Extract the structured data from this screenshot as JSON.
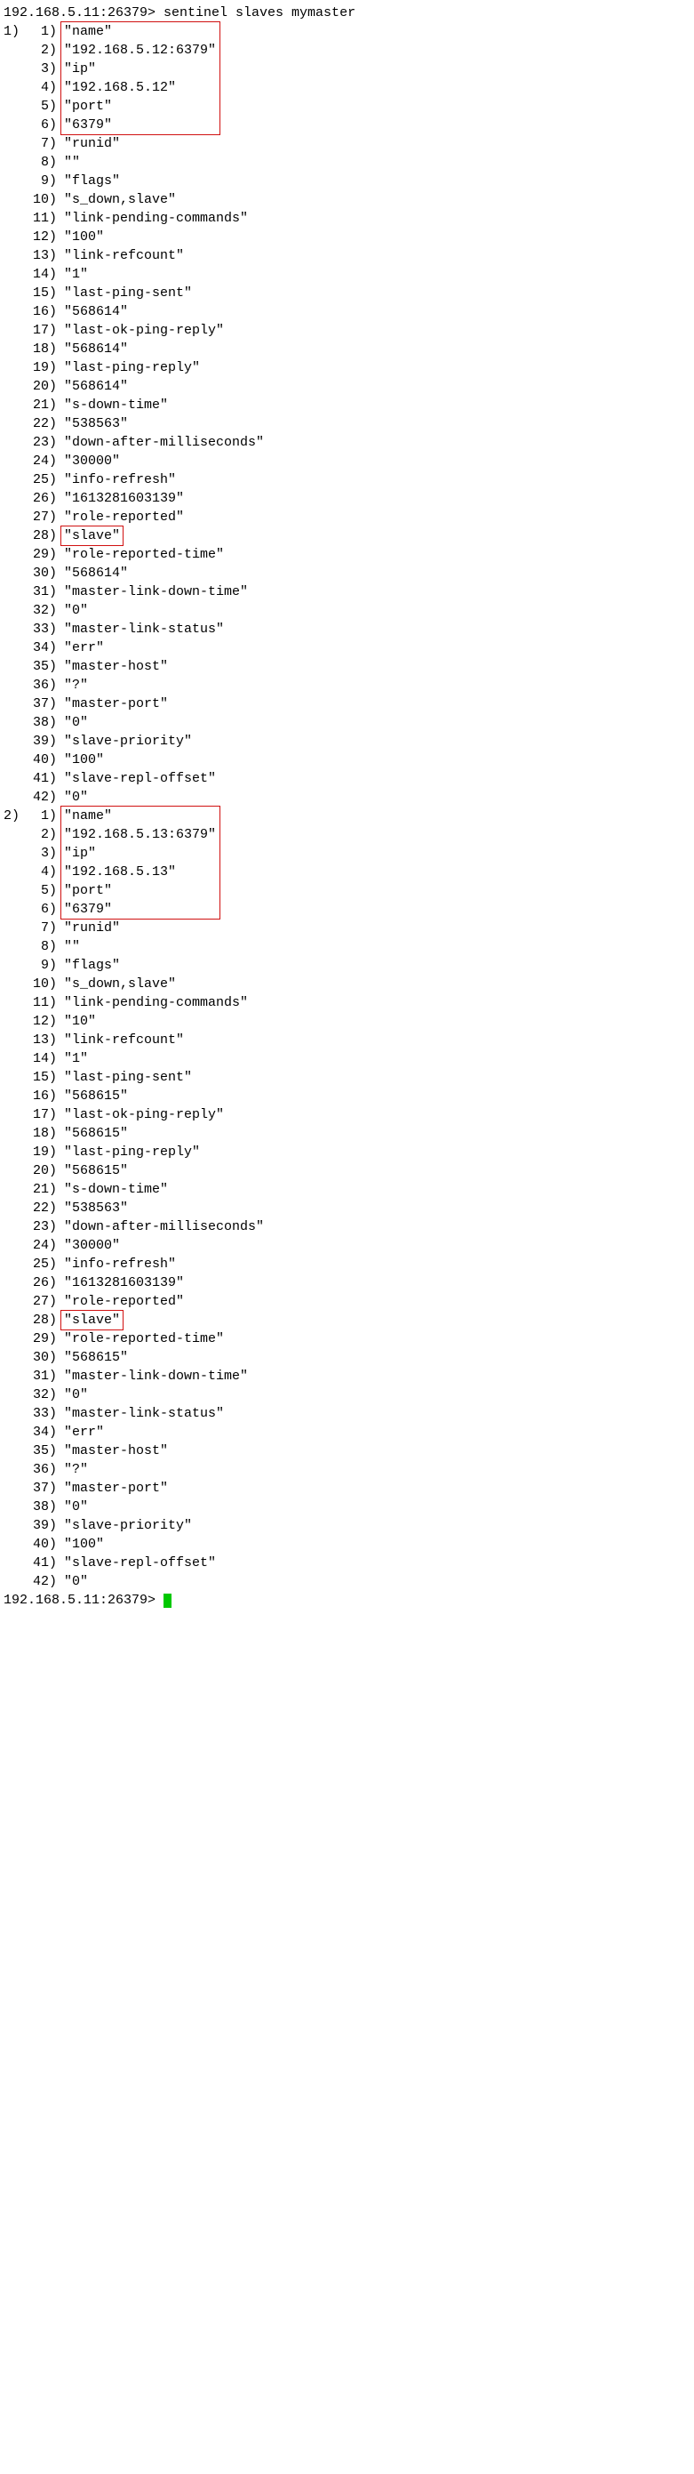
{
  "prompt_host": "192.168.5.11:26379>",
  "command": "sentinel slaves mymaster",
  "groups": [
    {
      "items": [
        "\"name\"",
        "\"192.168.5.12:6379\"",
        "\"ip\"",
        "\"192.168.5.12\"",
        "\"port\"",
        "\"6379\"",
        "\"runid\"",
        "\"\"",
        "\"flags\"",
        "\"s_down,slave\"",
        "\"link-pending-commands\"",
        "\"100\"",
        "\"link-refcount\"",
        "\"1\"",
        "\"last-ping-sent\"",
        "\"568614\"",
        "\"last-ok-ping-reply\"",
        "\"568614\"",
        "\"last-ping-reply\"",
        "\"568614\"",
        "\"s-down-time\"",
        "\"538563\"",
        "\"down-after-milliseconds\"",
        "\"30000\"",
        "\"info-refresh\"",
        "\"1613281603139\"",
        "\"role-reported\"",
        "\"slave\"",
        "\"role-reported-time\"",
        "\"568614\"",
        "\"master-link-down-time\"",
        "\"0\"",
        "\"master-link-status\"",
        "\"err\"",
        "\"master-host\"",
        "\"?\"",
        "\"master-port\"",
        "\"0\"",
        "\"slave-priority\"",
        "\"100\"",
        "\"slave-repl-offset\"",
        "\"0\""
      ],
      "box_ranges": [
        [
          0,
          5
        ],
        [
          27,
          27
        ]
      ]
    },
    {
      "items": [
        "\"name\"",
        "\"192.168.5.13:6379\"",
        "\"ip\"",
        "\"192.168.5.13\"",
        "\"port\"",
        "\"6379\"",
        "\"runid\"",
        "\"\"",
        "\"flags\"",
        "\"s_down,slave\"",
        "\"link-pending-commands\"",
        "\"10\"",
        "\"link-refcount\"",
        "\"1\"",
        "\"last-ping-sent\"",
        "\"568615\"",
        "\"last-ok-ping-reply\"",
        "\"568615\"",
        "\"last-ping-reply\"",
        "\"568615\"",
        "\"s-down-time\"",
        "\"538563\"",
        "\"down-after-milliseconds\"",
        "\"30000\"",
        "\"info-refresh\"",
        "\"1613281603139\"",
        "\"role-reported\"",
        "\"slave\"",
        "\"role-reported-time\"",
        "\"568615\"",
        "\"master-link-down-time\"",
        "\"0\"",
        "\"master-link-status\"",
        "\"err\"",
        "\"master-host\"",
        "\"?\"",
        "\"master-port\"",
        "\"0\"",
        "\"slave-priority\"",
        "\"100\"",
        "\"slave-repl-offset\"",
        "\"0\""
      ],
      "box_ranges": [
        [
          0,
          5
        ],
        [
          27,
          27
        ]
      ]
    }
  ]
}
